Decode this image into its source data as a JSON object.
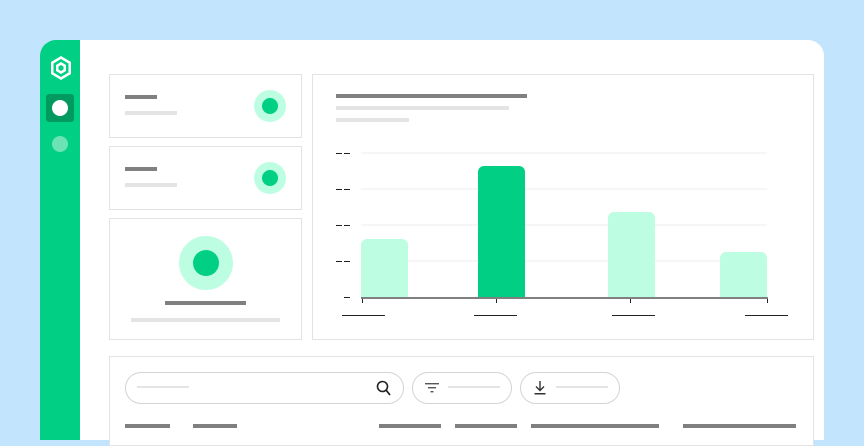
{
  "colors": {
    "background": "#c2e5fd",
    "sidebar": "#00cf84",
    "accent": "#00cf84",
    "accent_light": "#bdfde2",
    "sidebar_active": "#009a5f"
  },
  "sidebar": {
    "items": [
      {
        "icon": "logo-hexagon-icon"
      },
      {
        "icon": "circle-icon",
        "active": true
      },
      {
        "icon": "circle-icon",
        "active": false
      }
    ]
  },
  "toolbar": {
    "search_icon": "search-icon",
    "filter_icon": "filter-icon",
    "download_icon": "download-icon"
  },
  "chart_data": {
    "type": "bar",
    "categories": [
      "",
      "",
      "",
      ""
    ],
    "values": [
      1.6,
      3.65,
      2.35,
      1.25
    ],
    "highlighted_index": 1,
    "ylim": [
      0,
      4
    ],
    "grid": true,
    "title": "",
    "xlabel": "",
    "ylabel": ""
  }
}
